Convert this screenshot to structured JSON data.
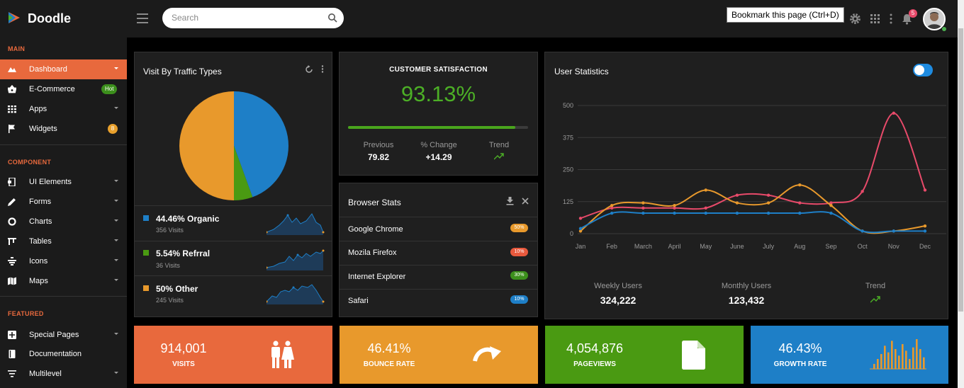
{
  "app": {
    "name": "Doodle"
  },
  "search": {
    "placeholder": "Search"
  },
  "tooltip": "Bookmark this page (Ctrl+D)",
  "notifications": {
    "count": "5"
  },
  "sidebar": {
    "sections": [
      {
        "title": "MAIN"
      },
      {
        "title": "COMPONENT"
      },
      {
        "title": "FEATURED"
      }
    ],
    "items": [
      {
        "label": "Dashboard",
        "icon": "dashboard-icon"
      },
      {
        "label": "E-Commerce",
        "icon": "basket-icon",
        "badge": "Hot"
      },
      {
        "label": "Apps",
        "icon": "grid-icon"
      },
      {
        "label": "Widgets",
        "icon": "flag-icon",
        "badge": "8"
      },
      {
        "label": "UI Elements",
        "icon": "ui-icon"
      },
      {
        "label": "Forms",
        "icon": "pencil-icon"
      },
      {
        "label": "Charts",
        "icon": "donut-icon"
      },
      {
        "label": "Tables",
        "icon": "table-icon"
      },
      {
        "label": "Icons",
        "icon": "icons-icon"
      },
      {
        "label": "Maps",
        "icon": "map-icon"
      },
      {
        "label": "Special Pages",
        "icon": "pages-icon"
      },
      {
        "label": "Documentation",
        "icon": "book-icon"
      },
      {
        "label": "Multilevel",
        "icon": "list-icon"
      }
    ]
  },
  "traffic": {
    "title": "Visit By Traffic Types",
    "items": [
      {
        "label": "44.46% Organic",
        "sub": "356 Visits",
        "color": "#1e7fc7"
      },
      {
        "label": "5.54% Refrral",
        "sub": "36 Visits",
        "color": "#4a9a12"
      },
      {
        "label": "50% Other",
        "sub": "245 Visits",
        "color": "#e8992c"
      }
    ],
    "pie": [
      {
        "value": 44.46,
        "color": "#1e7fc7"
      },
      {
        "value": 5.54,
        "color": "#4a9a12"
      },
      {
        "value": 50,
        "color": "#e8992c"
      }
    ]
  },
  "satisfaction": {
    "title": "CUSTOMER SATISFACTION",
    "value": "93.13%",
    "progress": 0.93,
    "previous_label": "Previous",
    "previous_value": "79.82",
    "change_label": "% Change",
    "change_value": "+14.29",
    "trend_label": "Trend"
  },
  "browser": {
    "title": "Browser Stats",
    "rows": [
      {
        "name": "Google Chrome",
        "pct": "50%",
        "color": "#e8992c"
      },
      {
        "name": "Mozila Firefox",
        "pct": "10%",
        "color": "#e8593d"
      },
      {
        "name": "Internet Explorer",
        "pct": "30%",
        "color": "#3c8f1c"
      },
      {
        "name": "Safari",
        "pct": "10%",
        "color": "#1e7fc7"
      }
    ]
  },
  "user_stats": {
    "title": "User Statistics",
    "weekly_label": "Weekly Users",
    "weekly_value": "324,222",
    "monthly_label": "Monthly Users",
    "monthly_value": "123,432",
    "trend_label": "Trend"
  },
  "chart_data": {
    "type": "line",
    "categories": [
      "Jan",
      "Feb",
      "March",
      "April",
      "May",
      "June",
      "July",
      "Aug",
      "Sep",
      "Oct",
      "Nov",
      "Dec"
    ],
    "y_ticks": [
      "0",
      "125",
      "250",
      "375",
      "500"
    ],
    "ylim": [
      0,
      500
    ],
    "grid": true,
    "series": [
      {
        "color": "#e84a6a",
        "values": [
          60,
          100,
          100,
          100,
          100,
          150,
          150,
          120,
          120,
          165,
          470,
          170
        ]
      },
      {
        "color": "#e8992c",
        "values": [
          10,
          110,
          120,
          110,
          170,
          120,
          120,
          190,
          110,
          10,
          10,
          30
        ]
      },
      {
        "color": "#1e7fc7",
        "values": [
          20,
          80,
          80,
          80,
          80,
          80,
          80,
          80,
          80,
          10,
          10,
          10
        ]
      }
    ]
  },
  "tiles": [
    {
      "value": "914,001",
      "label": "VISITS",
      "color": "#e8693d",
      "icon": "people-icon"
    },
    {
      "value": "46.41%",
      "label": "BOUNCE RATE",
      "color": "#e8992c",
      "icon": "redo-arrow-icon"
    },
    {
      "value": "4,054,876",
      "label": "PAGEVIEWS",
      "color": "#4a9a12",
      "icon": "file-icon"
    },
    {
      "value": "46.43%",
      "label": "GROWTH RATE",
      "color": "#1e7fc7",
      "icon": "bars-icon",
      "bars": [
        3,
        6,
        9,
        14,
        10,
        17,
        12,
        8,
        15,
        11,
        6,
        13,
        18,
        12,
        7
      ]
    }
  ]
}
